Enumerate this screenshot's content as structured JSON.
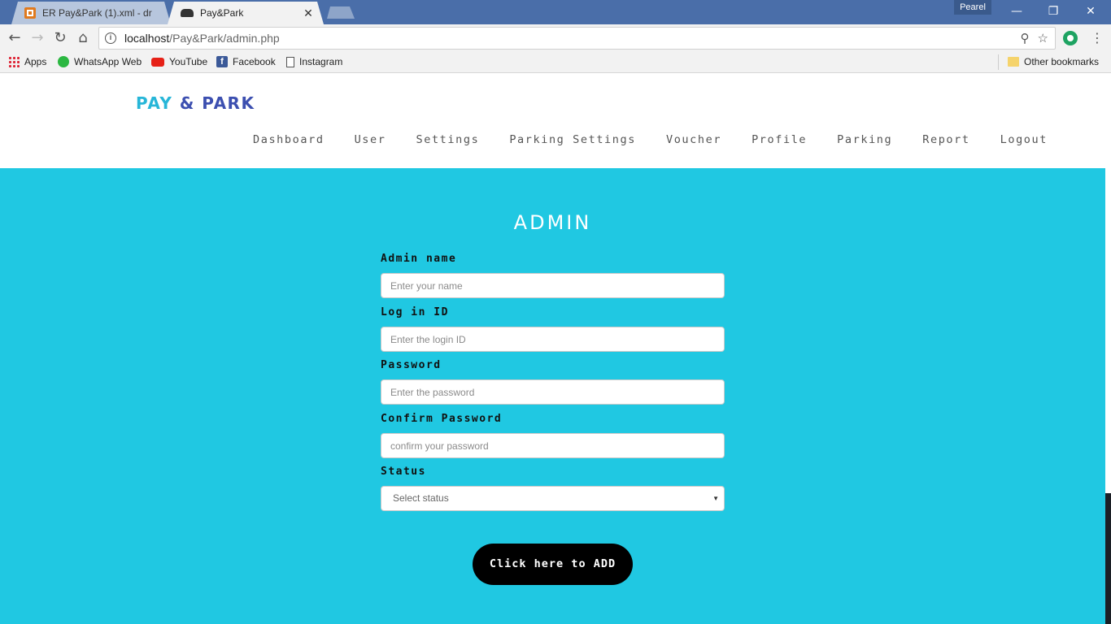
{
  "browser": {
    "tabs": [
      {
        "title": "ER Pay&Park (1).xml - dr",
        "active": false
      },
      {
        "title": "Pay&Park",
        "active": true
      }
    ],
    "profile": "Pearel",
    "url_host": "localhost",
    "url_path": "/Pay&Park/admin.php",
    "bookmarks": [
      {
        "label": "Apps",
        "icon": "apps-grid-icon"
      },
      {
        "label": "WhatsApp Web",
        "icon": "whatsapp-icon"
      },
      {
        "label": "YouTube",
        "icon": "youtube-icon"
      },
      {
        "label": "Facebook",
        "icon": "facebook-icon"
      },
      {
        "label": "Instagram",
        "icon": "page-icon"
      }
    ],
    "other_bookmarks": "Other bookmarks"
  },
  "site": {
    "brand_pay": "PAY",
    "brand_rest": "& PARK",
    "nav": [
      "Dashboard",
      "User",
      "Settings",
      "Parking Settings",
      "Voucher",
      "Profile",
      "Parking",
      "Report",
      "Logout"
    ]
  },
  "form": {
    "title": "ADMIN",
    "fields": [
      {
        "label": "Admin name",
        "placeholder": "Enter your name"
      },
      {
        "label": "Log in ID",
        "placeholder": "Enter the login ID"
      },
      {
        "label": "Password",
        "placeholder": "Enter the password"
      },
      {
        "label": "Confirm Password",
        "placeholder": "confirm your password"
      }
    ],
    "status_label": "Status",
    "status_value": "Select status",
    "submit": "Click here to ADD"
  },
  "colors": {
    "content_bg": "#20c8e2",
    "brand_blue": "#3c4fb0",
    "brand_cyan": "#27b6d8",
    "button_bg": "#000000"
  }
}
